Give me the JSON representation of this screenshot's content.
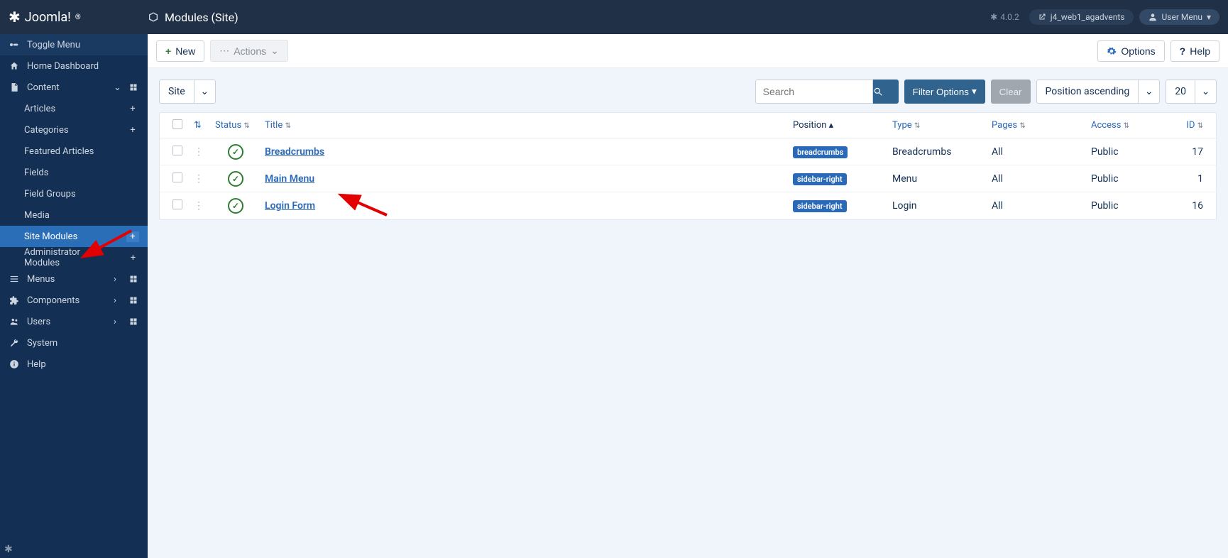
{
  "brand": "Joomla!",
  "page_title": "Modules (Site)",
  "version": "4.0.2",
  "site_badge": "j4_web1_agadvents",
  "user_menu": "User Menu",
  "sidebar": {
    "toggle": "Toggle Menu",
    "home": "Home Dashboard",
    "content": "Content",
    "content_sub": {
      "articles": "Articles",
      "categories": "Categories",
      "featured": "Featured Articles",
      "fields": "Fields",
      "field_groups": "Field Groups",
      "media": "Media",
      "site_modules": "Site Modules",
      "admin_modules": "Administrator Modules"
    },
    "menus": "Menus",
    "components": "Components",
    "users": "Users",
    "system": "System",
    "help": "Help"
  },
  "toolbar": {
    "new": "New",
    "actions": "Actions",
    "options": "Options",
    "help": "Help"
  },
  "filters": {
    "client": "Site",
    "search_placeholder": "Search",
    "filter_options": "Filter Options",
    "clear": "Clear",
    "ordering": "Position ascending",
    "limit": "20"
  },
  "columns": {
    "status": "Status",
    "title": "Title",
    "position": "Position",
    "type": "Type",
    "pages": "Pages",
    "access": "Access",
    "id": "ID"
  },
  "rows": [
    {
      "title": "Breadcrumbs",
      "position": "breadcrumbs",
      "type": "Breadcrumbs",
      "pages": "All",
      "access": "Public",
      "id": "17"
    },
    {
      "title": "Main Menu",
      "position": "sidebar-right",
      "type": "Menu",
      "pages": "All",
      "access": "Public",
      "id": "1"
    },
    {
      "title": "Login Form",
      "position": "sidebar-right",
      "type": "Login",
      "pages": "All",
      "access": "Public",
      "id": "16"
    }
  ]
}
